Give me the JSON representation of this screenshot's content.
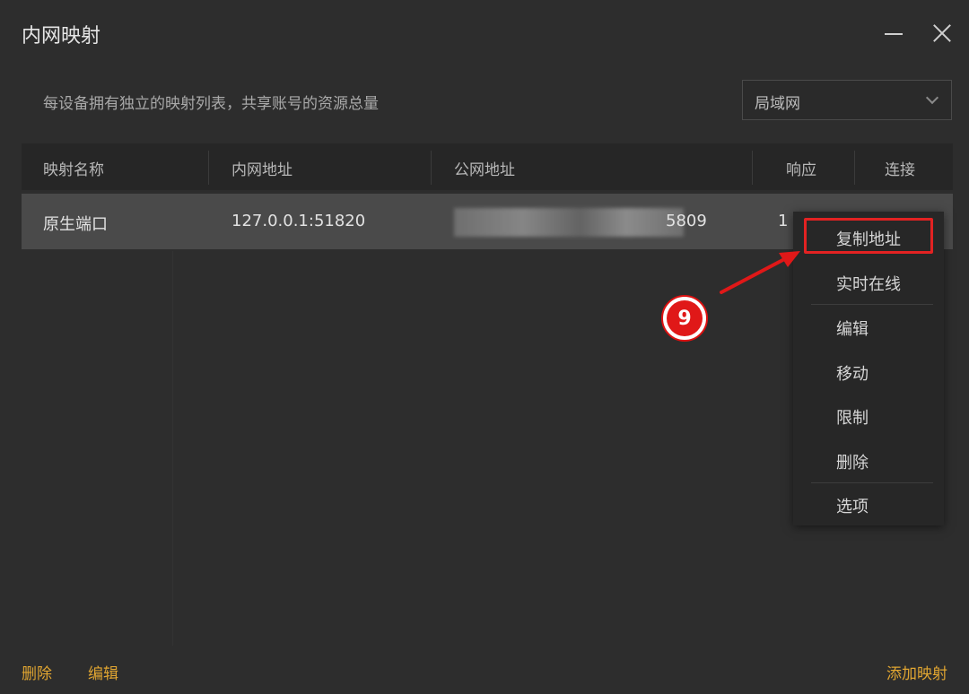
{
  "window": {
    "title": "内网映射"
  },
  "description": "每设备拥有独立的映射列表，共享账号的资源总量",
  "network_select": {
    "value": "局域网"
  },
  "table": {
    "columns": [
      "映射名称",
      "内网地址",
      "公网地址",
      "响应",
      "连接"
    ],
    "rows": [
      {
        "name": "原生端口",
        "local": "127.0.0.1:51820",
        "public_suffix": "5809",
        "response_partial": "1"
      }
    ]
  },
  "context_menu": {
    "items": [
      "复制地址",
      "实时在线",
      "编辑",
      "移动",
      "限制",
      "删除",
      "选项"
    ],
    "highlighted": "复制地址"
  },
  "annotation": {
    "step": "9",
    "color": "#e01818"
  },
  "footer": {
    "delete": "删除",
    "edit": "编辑",
    "add": "添加映射"
  },
  "colors": {
    "accent": "#e0a531",
    "selected_row": "#4a4a4a"
  }
}
